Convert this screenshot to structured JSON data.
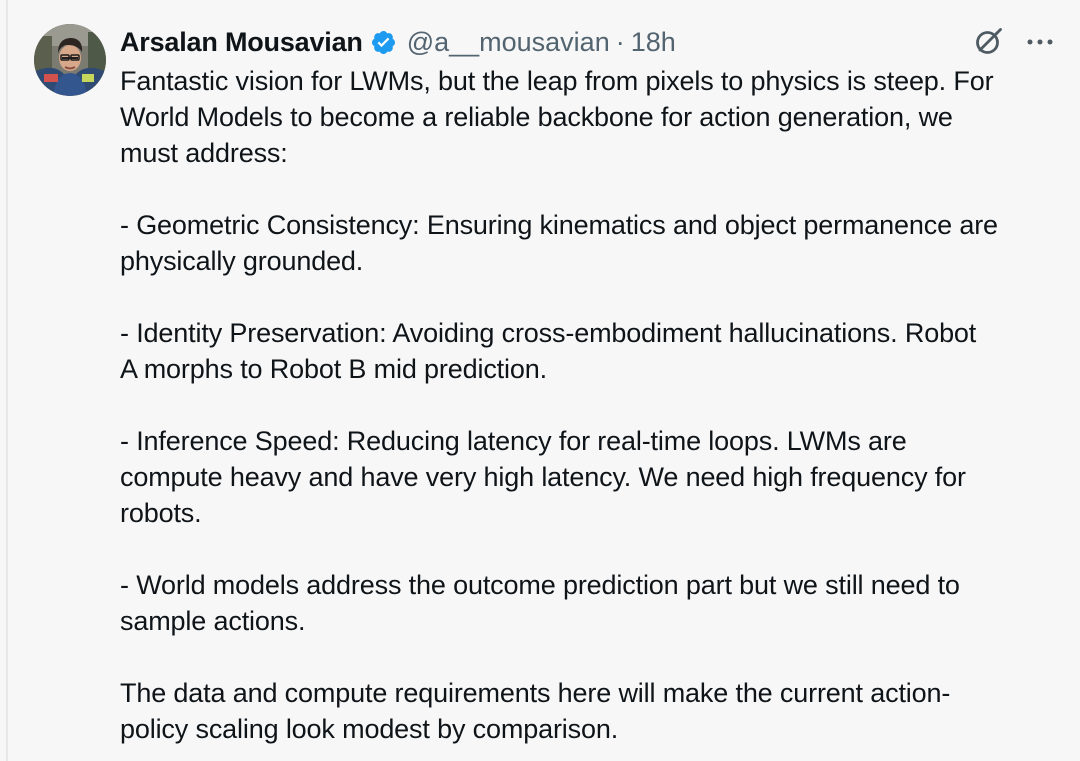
{
  "tweet": {
    "author": {
      "name": "Arsalan Mousavian",
      "handle": "@a__mousavian",
      "separator": "·",
      "time": "18h",
      "verified": true,
      "avatar_icon": "profile-photo"
    },
    "icons": {
      "verified": "verified-badge-icon",
      "grok": "grok-icon",
      "more": "more-options-icon"
    },
    "colors": {
      "verified_blue": "#1d9bf0",
      "text": "#0f1419",
      "muted": "#536471",
      "background": "#f7f7f7"
    },
    "text": "Fantastic vision for LWMs, but the leap from pixels to physics is steep. For\nWorld Models to become a reliable backbone for action generation, we\nmust address:\n\n- Geometric Consistency: Ensuring kinematics and object permanence are\nphysically grounded.\n\n- Identity Preservation: Avoiding cross-embodiment hallucinations. Robot\nA morphs to Robot B mid prediction.\n\n- Inference Speed: Reducing latency for real-time loops. LWMs are\ncompute heavy and have very high latency. We need high frequency for\nrobots.\n\n- World models address the outcome prediction part but we still need to\nsample actions.\n\nThe data and compute requirements here will make the current action-\npolicy scaling look modest by comparison."
  }
}
